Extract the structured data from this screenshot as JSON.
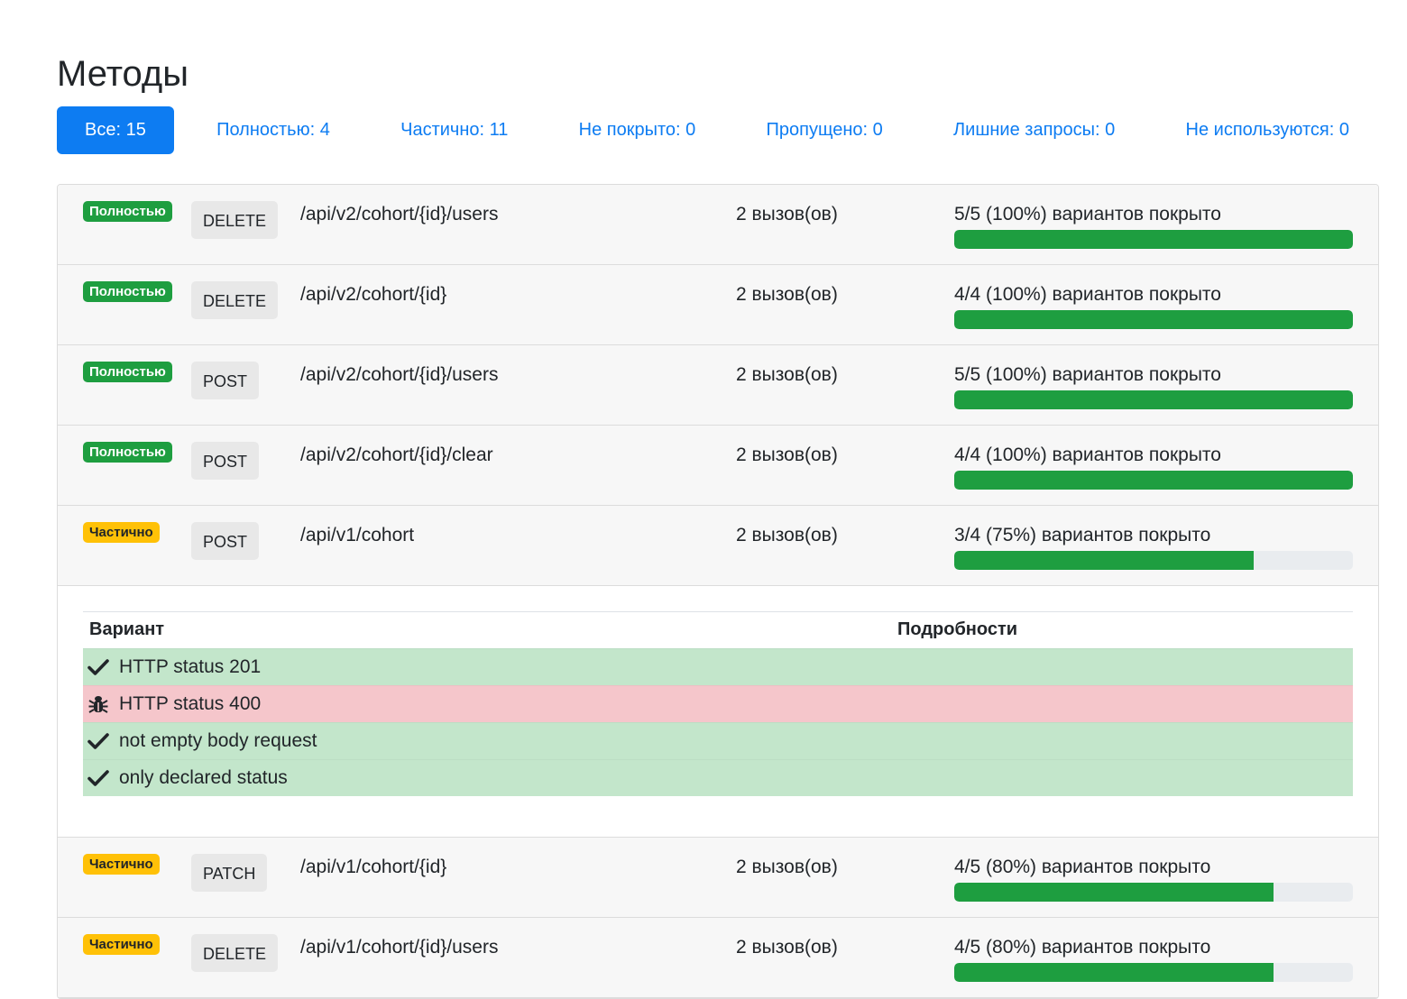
{
  "page": {
    "title": "Методы"
  },
  "tabs": [
    {
      "label": "Все: 15",
      "active": true
    },
    {
      "label": "Полностью: 4",
      "active": false
    },
    {
      "label": "Частично: 11",
      "active": false
    },
    {
      "label": "Не покрыто: 0",
      "active": false
    },
    {
      "label": "Пропущено: 0",
      "active": false
    },
    {
      "label": "Лишние запросы: 0",
      "active": false
    },
    {
      "label": "Не используются: 0",
      "active": false
    }
  ],
  "colors": {
    "accent": "#0d7cf2",
    "full_badge": "#1e9e40",
    "partial_badge": "#ffc107",
    "progress_fill": "#1e9e40",
    "variant_ok": "#c3e6cb",
    "variant_bug": "#f5c6cb"
  },
  "methods": [
    {
      "status": "Полностью",
      "status_type": "full",
      "method": "DELETE",
      "path": "/api/v2/cohort/{id}/users",
      "calls": "2 вызов(ов)",
      "coverage": "5/5 (100%) вариантов покрыто",
      "coverage_fraction": 1.0
    },
    {
      "status": "Полностью",
      "status_type": "full",
      "method": "DELETE",
      "path": "/api/v2/cohort/{id}",
      "calls": "2 вызов(ов)",
      "coverage": "4/4 (100%) вариантов покрыто",
      "coverage_fraction": 1.0
    },
    {
      "status": "Полностью",
      "status_type": "full",
      "method": "POST",
      "path": "/api/v2/cohort/{id}/users",
      "calls": "2 вызов(ов)",
      "coverage": "5/5 (100%) вариантов покрыто",
      "coverage_fraction": 1.0
    },
    {
      "status": "Полностью",
      "status_type": "full",
      "method": "POST",
      "path": "/api/v2/cohort/{id}/clear",
      "calls": "2 вызов(ов)",
      "coverage": "4/4 (100%) вариантов покрыто",
      "coverage_fraction": 1.0
    },
    {
      "status": "Частично",
      "status_type": "partial",
      "method": "POST",
      "path": "/api/v1/cohort",
      "calls": "2 вызов(ов)",
      "coverage": "3/4 (75%) вариантов покрыто",
      "coverage_fraction": 0.75,
      "expanded": true,
      "details": {
        "header_variant": "Вариант",
        "header_details": "Подробности",
        "variants": [
          {
            "icon": "check-icon",
            "label": "HTTP status 201",
            "state": "ok"
          },
          {
            "icon": "bug-icon",
            "label": "HTTP status 400",
            "state": "bug"
          },
          {
            "icon": "check-icon",
            "label": "not empty body request",
            "state": "ok"
          },
          {
            "icon": "check-icon",
            "label": "only declared status",
            "state": "ok"
          }
        ]
      }
    },
    {
      "status": "Частично",
      "status_type": "partial",
      "method": "PATCH",
      "path": "/api/v1/cohort/{id}",
      "calls": "2 вызов(ов)",
      "coverage": "4/5 (80%) вариантов покрыто",
      "coverage_fraction": 0.8
    },
    {
      "status": "Частично",
      "status_type": "partial",
      "method": "DELETE",
      "path": "/api/v1/cohort/{id}/users",
      "calls": "2 вызов(ов)",
      "coverage": "4/5 (80%) вариантов покрыто",
      "coverage_fraction": 0.8
    }
  ]
}
